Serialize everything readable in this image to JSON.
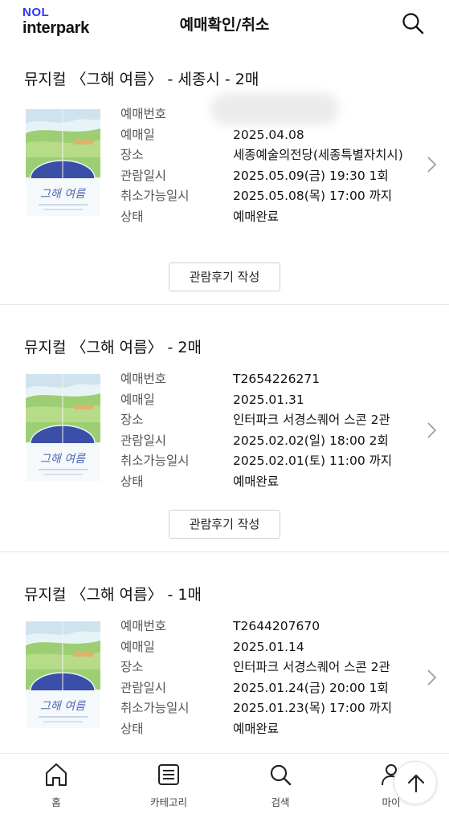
{
  "header": {
    "logo_top": "NOL",
    "logo_bottom": "interpark",
    "title": "예매확인/취소",
    "search_icon": "search-icon"
  },
  "bookings": [
    {
      "title": "뮤지컬 〈그해 여름〉 - 세종시 - 2매",
      "rows": [
        {
          "k": "예매번호",
          "v": ""
        },
        {
          "k": "예매일",
          "v": "2025.04.08"
        },
        {
          "k": "장소",
          "v": "세종예술의전당(세종특별자치시)"
        },
        {
          "k": "관람일시",
          "v": "2025.05.09(금) 19:30 1회"
        },
        {
          "k": "취소가능일시",
          "v": "2025.05.08(목) 17:00 까지"
        },
        {
          "k": "상태",
          "v": "예매완료"
        }
      ],
      "review_label": "관람후기 작성",
      "poster_text": "그해 여름"
    },
    {
      "title": "뮤지컬 〈그해 여름〉 - 2매",
      "rows": [
        {
          "k": "예매번호",
          "v": "T2654226271"
        },
        {
          "k": "예매일",
          "v": "2025.01.31"
        },
        {
          "k": "장소",
          "v": "인터파크 서경스퀘어 스콘 2관"
        },
        {
          "k": "관람일시",
          "v": "2025.02.02(일) 18:00 2회"
        },
        {
          "k": "취소가능일시",
          "v": "2025.02.01(토) 11:00 까지"
        },
        {
          "k": "상태",
          "v": "예매완료"
        }
      ],
      "review_label": "관람후기 작성",
      "poster_text": "그해 여름"
    },
    {
      "title": "뮤지컬 〈그해 여름〉 - 1매",
      "rows": [
        {
          "k": "예매번호",
          "v": "T2644207670"
        },
        {
          "k": "예매일",
          "v": "2025.01.14"
        },
        {
          "k": "장소",
          "v": "인터파크 서경스퀘어 스콘 2관"
        },
        {
          "k": "관람일시",
          "v": "2025.01.24(금) 20:00 1회"
        },
        {
          "k": "취소가능일시",
          "v": "2025.01.23(목) 17:00 까지"
        },
        {
          "k": "상태",
          "v": "예매완료"
        }
      ],
      "poster_text": "그해 여름"
    }
  ],
  "nav": [
    {
      "label": "홈",
      "icon": "home-icon"
    },
    {
      "label": "카테고리",
      "icon": "category-list-icon"
    },
    {
      "label": "검색",
      "icon": "search-icon"
    },
    {
      "label": "마이",
      "icon": "user-icon"
    }
  ],
  "fab_icon": "arrow-up-icon",
  "colors": {
    "brand_blue": "#2a37ff",
    "poster_sky": "#dfeef6",
    "poster_field": "#8cc56a",
    "poster_disc": "#3b4fa8"
  }
}
